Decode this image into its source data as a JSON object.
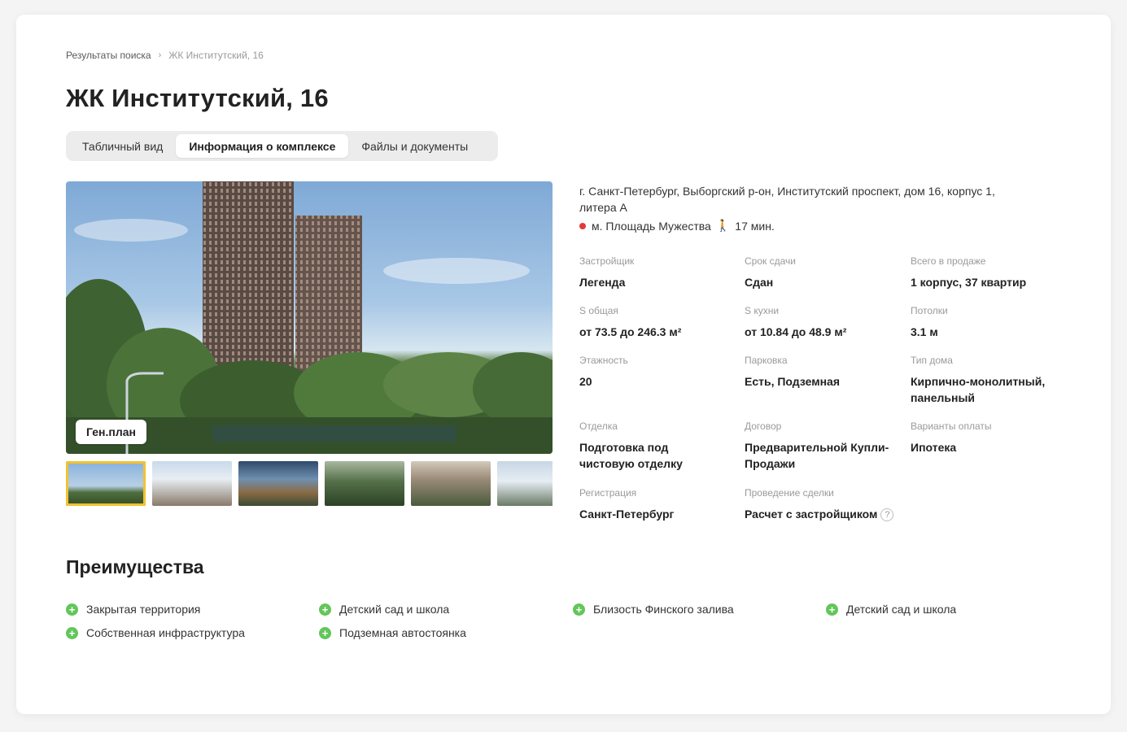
{
  "breadcrumb": {
    "parent": "Результаты поиска",
    "separator": "›",
    "current": "ЖК Институтский, 16"
  },
  "title": "ЖК Институтский, 16",
  "tabs": [
    {
      "label": "Табличный вид",
      "active": false
    },
    {
      "label": "Информация о комплексе",
      "active": true
    },
    {
      "label": "Файлы и документы",
      "active": false
    }
  ],
  "gallery": {
    "genplan_label": "Ген.план",
    "thumbnails_count_visible": 6,
    "selected_index": 0
  },
  "address": "г. Санкт-Петербург, Выборгский р-он, Институтский проспект, дом 16, корпус 1, литера А",
  "metro": {
    "station": "м. Площадь Мужества",
    "walk_icon": "walking-person-icon",
    "time": "17 мин.",
    "line_color": "#e23b3b"
  },
  "properties": {
    "developer": {
      "label": "Застройщик",
      "value": "Легенда"
    },
    "deadline": {
      "label": "Срок сдачи",
      "value": "Сдан"
    },
    "on_sale": {
      "label": "Всего в продаже",
      "value": "1 корпус, 37 квартир"
    },
    "area_total": {
      "label": "S общая",
      "value": "от 73.5 до 246.3 м²"
    },
    "area_kitchen": {
      "label": "S кухни",
      "value": "от 10.84 до 48.9 м²"
    },
    "ceilings": {
      "label": "Потолки",
      "value": "3.1 м"
    },
    "floors": {
      "label": "Этажность",
      "value": "20"
    },
    "parking": {
      "label": "Парковка",
      "value": "Есть, Подземная"
    },
    "house_type": {
      "label": "Тип дома",
      "value": "Кирпично-монолитный, панельный"
    },
    "finishing": {
      "label": "Отделка",
      "value": "Подготовка под чистовую отделку"
    },
    "contract": {
      "label": "Договор",
      "value": "Предварительной Купли-Продажи"
    },
    "payment": {
      "label": "Варианты оплаты",
      "value": "Ипотека"
    },
    "registration": {
      "label": "Регистрация",
      "value": "Санкт-Петербург"
    },
    "deal": {
      "label": "Проведение сделки",
      "value": "Расчет с застройщиком",
      "help": "?"
    }
  },
  "advantages": {
    "title": "Преимущества",
    "items": [
      "Закрытая территория",
      "Собственная инфраструктура",
      "Детский сад и школа",
      "Подземная автостоянка",
      "Близость Финского залива",
      "Детский сад и школа"
    ],
    "icon": "plus-circle-icon",
    "icon_color": "#62c65a"
  },
  "colors": {
    "thumb_selected": "#f2c230",
    "tab_bg": "#ececec"
  }
}
